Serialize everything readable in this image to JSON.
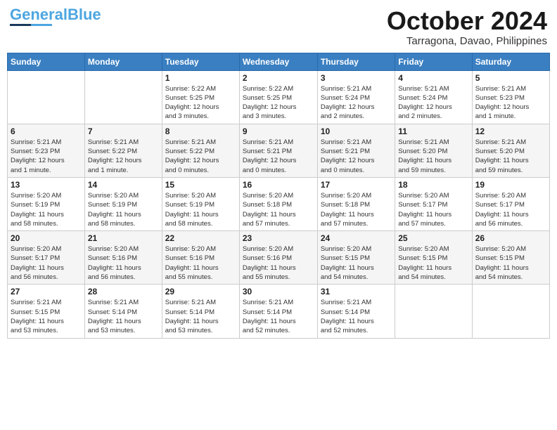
{
  "logo": {
    "part1": "General",
    "part2": "Blue"
  },
  "title": "October 2024",
  "location": "Tarragona, Davao, Philippines",
  "headers": [
    "Sunday",
    "Monday",
    "Tuesday",
    "Wednesday",
    "Thursday",
    "Friday",
    "Saturday"
  ],
  "weeks": [
    [
      {
        "day": "",
        "info": ""
      },
      {
        "day": "",
        "info": ""
      },
      {
        "day": "1",
        "info": "Sunrise: 5:22 AM\nSunset: 5:25 PM\nDaylight: 12 hours\nand 3 minutes."
      },
      {
        "day": "2",
        "info": "Sunrise: 5:22 AM\nSunset: 5:25 PM\nDaylight: 12 hours\nand 3 minutes."
      },
      {
        "day": "3",
        "info": "Sunrise: 5:21 AM\nSunset: 5:24 PM\nDaylight: 12 hours\nand 2 minutes."
      },
      {
        "day": "4",
        "info": "Sunrise: 5:21 AM\nSunset: 5:24 PM\nDaylight: 12 hours\nand 2 minutes."
      },
      {
        "day": "5",
        "info": "Sunrise: 5:21 AM\nSunset: 5:23 PM\nDaylight: 12 hours\nand 1 minute."
      }
    ],
    [
      {
        "day": "6",
        "info": "Sunrise: 5:21 AM\nSunset: 5:23 PM\nDaylight: 12 hours\nand 1 minute."
      },
      {
        "day": "7",
        "info": "Sunrise: 5:21 AM\nSunset: 5:22 PM\nDaylight: 12 hours\nand 1 minute."
      },
      {
        "day": "8",
        "info": "Sunrise: 5:21 AM\nSunset: 5:22 PM\nDaylight: 12 hours\nand 0 minutes."
      },
      {
        "day": "9",
        "info": "Sunrise: 5:21 AM\nSunset: 5:21 PM\nDaylight: 12 hours\nand 0 minutes."
      },
      {
        "day": "10",
        "info": "Sunrise: 5:21 AM\nSunset: 5:21 PM\nDaylight: 12 hours\nand 0 minutes."
      },
      {
        "day": "11",
        "info": "Sunrise: 5:21 AM\nSunset: 5:20 PM\nDaylight: 11 hours\nand 59 minutes."
      },
      {
        "day": "12",
        "info": "Sunrise: 5:21 AM\nSunset: 5:20 PM\nDaylight: 11 hours\nand 59 minutes."
      }
    ],
    [
      {
        "day": "13",
        "info": "Sunrise: 5:20 AM\nSunset: 5:19 PM\nDaylight: 11 hours\nand 58 minutes."
      },
      {
        "day": "14",
        "info": "Sunrise: 5:20 AM\nSunset: 5:19 PM\nDaylight: 11 hours\nand 58 minutes."
      },
      {
        "day": "15",
        "info": "Sunrise: 5:20 AM\nSunset: 5:19 PM\nDaylight: 11 hours\nand 58 minutes."
      },
      {
        "day": "16",
        "info": "Sunrise: 5:20 AM\nSunset: 5:18 PM\nDaylight: 11 hours\nand 57 minutes."
      },
      {
        "day": "17",
        "info": "Sunrise: 5:20 AM\nSunset: 5:18 PM\nDaylight: 11 hours\nand 57 minutes."
      },
      {
        "day": "18",
        "info": "Sunrise: 5:20 AM\nSunset: 5:17 PM\nDaylight: 11 hours\nand 57 minutes."
      },
      {
        "day": "19",
        "info": "Sunrise: 5:20 AM\nSunset: 5:17 PM\nDaylight: 11 hours\nand 56 minutes."
      }
    ],
    [
      {
        "day": "20",
        "info": "Sunrise: 5:20 AM\nSunset: 5:17 PM\nDaylight: 11 hours\nand 56 minutes."
      },
      {
        "day": "21",
        "info": "Sunrise: 5:20 AM\nSunset: 5:16 PM\nDaylight: 11 hours\nand 56 minutes."
      },
      {
        "day": "22",
        "info": "Sunrise: 5:20 AM\nSunset: 5:16 PM\nDaylight: 11 hours\nand 55 minutes."
      },
      {
        "day": "23",
        "info": "Sunrise: 5:20 AM\nSunset: 5:16 PM\nDaylight: 11 hours\nand 55 minutes."
      },
      {
        "day": "24",
        "info": "Sunrise: 5:20 AM\nSunset: 5:15 PM\nDaylight: 11 hours\nand 54 minutes."
      },
      {
        "day": "25",
        "info": "Sunrise: 5:20 AM\nSunset: 5:15 PM\nDaylight: 11 hours\nand 54 minutes."
      },
      {
        "day": "26",
        "info": "Sunrise: 5:20 AM\nSunset: 5:15 PM\nDaylight: 11 hours\nand 54 minutes."
      }
    ],
    [
      {
        "day": "27",
        "info": "Sunrise: 5:21 AM\nSunset: 5:15 PM\nDaylight: 11 hours\nand 53 minutes."
      },
      {
        "day": "28",
        "info": "Sunrise: 5:21 AM\nSunset: 5:14 PM\nDaylight: 11 hours\nand 53 minutes."
      },
      {
        "day": "29",
        "info": "Sunrise: 5:21 AM\nSunset: 5:14 PM\nDaylight: 11 hours\nand 53 minutes."
      },
      {
        "day": "30",
        "info": "Sunrise: 5:21 AM\nSunset: 5:14 PM\nDaylight: 11 hours\nand 52 minutes."
      },
      {
        "day": "31",
        "info": "Sunrise: 5:21 AM\nSunset: 5:14 PM\nDaylight: 11 hours\nand 52 minutes."
      },
      {
        "day": "",
        "info": ""
      },
      {
        "day": "",
        "info": ""
      }
    ]
  ]
}
